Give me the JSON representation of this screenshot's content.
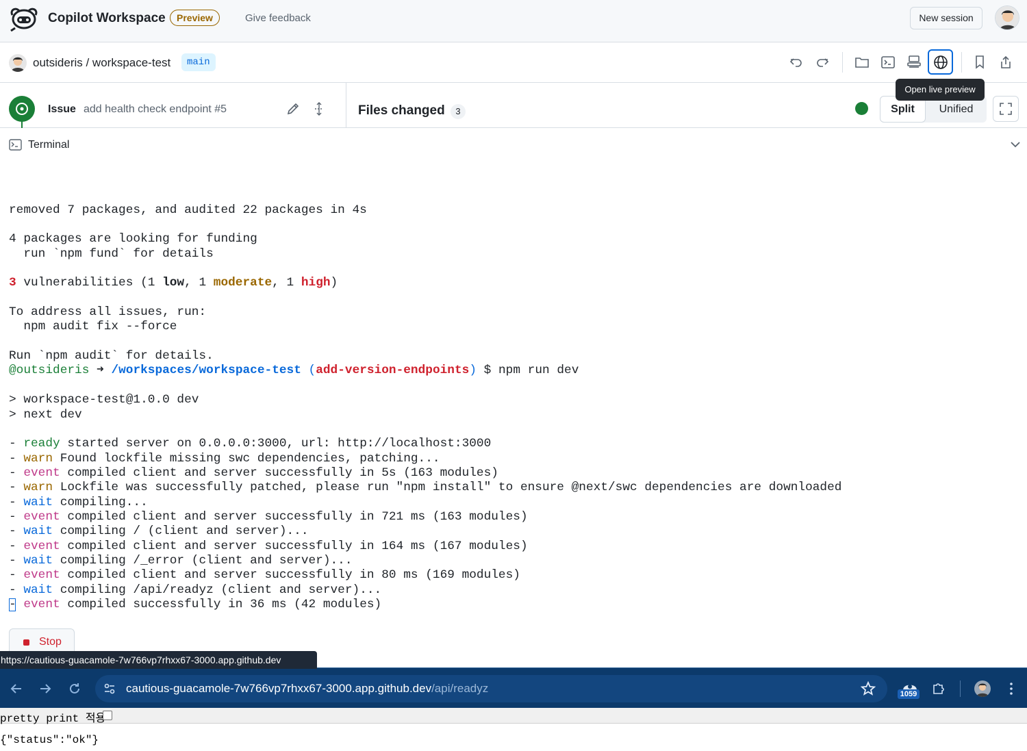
{
  "header": {
    "app_title": "Copilot Workspace",
    "preview_badge": "Preview",
    "feedback_link": "Give feedback",
    "new_session_label": "New session"
  },
  "repo": {
    "path": "outsideris / workspace-test",
    "branch": "main",
    "tooltip": "Open live preview"
  },
  "issue": {
    "label": "Issue",
    "title": "add health check endpoint #5"
  },
  "files": {
    "label": "Files changed",
    "count": "3",
    "view_split": "Split",
    "view_unified": "Unified"
  },
  "terminal": {
    "title": "Terminal",
    "lines": [
      [],
      [],
      [
        {
          "t": "removed 7 packages, and audited 22 packages in 4s"
        }
      ],
      [],
      [
        {
          "t": "4 packages are looking for funding"
        }
      ],
      [
        {
          "t": "  run `npm fund` for details"
        }
      ],
      [],
      [
        {
          "t": "3",
          "c": "red"
        },
        {
          "t": " vulnerabilities (1 "
        },
        {
          "t": "low",
          "c": "bold"
        },
        {
          "t": ", 1 "
        },
        {
          "t": "moderate",
          "c": "yellow"
        },
        {
          "t": ", 1 "
        },
        {
          "t": "high",
          "c": "redb"
        },
        {
          "t": ")"
        }
      ],
      [],
      [
        {
          "t": "To address all issues, run:"
        }
      ],
      [
        {
          "t": "  npm audit fix --force"
        }
      ],
      [],
      [
        {
          "t": "Run `npm audit` for details."
        }
      ],
      [
        {
          "t": "@outsideris",
          "c": "green"
        },
        {
          "t": " ➜ "
        },
        {
          "t": "/workspaces/workspace-test",
          "c": "blue"
        },
        {
          "t": " "
        },
        {
          "t": "(",
          "c": "wait"
        },
        {
          "t": "add-version-endpoints",
          "c": "redb"
        },
        {
          "t": ")",
          "c": "wait"
        },
        {
          "t": " $ npm run dev"
        }
      ],
      [],
      [
        {
          "t": "> workspace-test@1.0.0 dev"
        }
      ],
      [
        {
          "t": "> next dev"
        }
      ],
      [],
      [
        {
          "t": "- "
        },
        {
          "t": "ready",
          "c": "green"
        },
        {
          "t": " started server on 0.0.0.0:3000, url: http://localhost:3000"
        }
      ],
      [
        {
          "t": "- "
        },
        {
          "t": "warn",
          "c": "warn"
        },
        {
          "t": " Found lockfile missing swc dependencies, patching..."
        }
      ],
      [
        {
          "t": "- "
        },
        {
          "t": "event",
          "c": "event"
        },
        {
          "t": " compiled client and server successfully in 5s (163 modules)"
        }
      ],
      [
        {
          "t": "- "
        },
        {
          "t": "warn",
          "c": "warn"
        },
        {
          "t": " Lockfile was successfully patched, please run \"npm install\" to ensure @next/swc dependencies are downloaded"
        }
      ],
      [
        {
          "t": "- "
        },
        {
          "t": "wait",
          "c": "wait"
        },
        {
          "t": " compiling..."
        }
      ],
      [
        {
          "t": "- "
        },
        {
          "t": "event",
          "c": "event"
        },
        {
          "t": " compiled client and server successfully in 721 ms (163 modules)"
        }
      ],
      [
        {
          "t": "- "
        },
        {
          "t": "wait",
          "c": "wait"
        },
        {
          "t": " compiling / (client and server)..."
        }
      ],
      [
        {
          "t": "- "
        },
        {
          "t": "event",
          "c": "event"
        },
        {
          "t": " compiled client and server successfully in 164 ms (167 modules)"
        }
      ],
      [
        {
          "t": "- "
        },
        {
          "t": "wait",
          "c": "wait"
        },
        {
          "t": " compiling /_error (client and server)..."
        }
      ],
      [
        {
          "t": "- "
        },
        {
          "t": "event",
          "c": "event"
        },
        {
          "t": " compiled client and server successfully in 80 ms (169 modules)"
        }
      ],
      [
        {
          "t": "- "
        },
        {
          "t": "wait",
          "c": "wait"
        },
        {
          "t": " compiling /api/readyz (client and server)..."
        }
      ],
      [
        {
          "t": "- "
        },
        {
          "t": "event",
          "c": "event"
        },
        {
          "t": " compiled successfully in 36 ms (42 modules)"
        }
      ]
    ],
    "stop_label": "Stop"
  },
  "status_url": "https://cautious-guacamole-7w766vp7rhxx67-3000.app.github.dev",
  "browser": {
    "url_host": "cautious-guacamole-7w766vp7rhxx67-3000.app.github.dev",
    "url_path": "/api/readyz",
    "extension_badge": "1059"
  },
  "viewer": {
    "pretty_print_label": "pretty print 적용",
    "output": "{\"status\":\"ok\"}"
  },
  "colors": {
    "accent": "#0969da",
    "success": "#1a7f37",
    "danger": "#cf222e",
    "attention": "#9a6700",
    "browser_frame": "#0c3a6b"
  },
  "icons": {
    "logo": "copilot-logo-icon",
    "undo": "undo-icon",
    "redo": "redo-icon",
    "folder": "folder-icon",
    "terminal": "terminal-icon",
    "server": "server-icon",
    "globe": "globe-icon",
    "bookmark": "bookmark-icon",
    "share": "share-icon",
    "fullscreen": "fullscreen-icon"
  }
}
